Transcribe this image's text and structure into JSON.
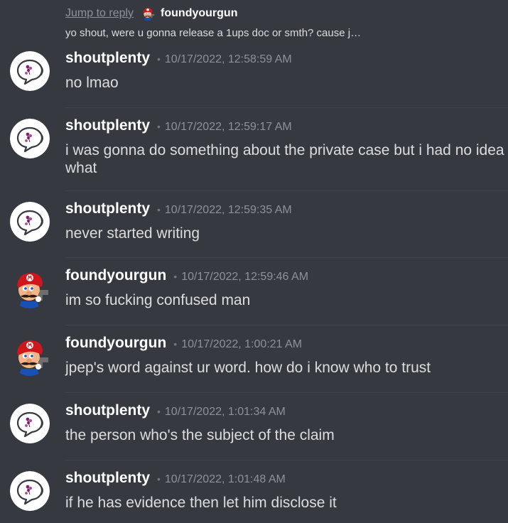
{
  "reply": {
    "jump_label": "Jump to reply",
    "author": "foundyourgun",
    "preview": "yo shout, were u gonna release a 1ups doc or smth? cause j…"
  },
  "colors": {
    "background": "#36393f",
    "username": "#ffffff",
    "message_text": "#dcddde",
    "timestamp": "#8e9297",
    "divider": "#3f4248"
  },
  "messages": [
    {
      "author": "shoutplenty",
      "avatar": "speech-bubble-avatar",
      "separator": "•",
      "timestamp": "10/17/2022, 12:58:59 AM",
      "text": "no lmao"
    },
    {
      "author": "shoutplenty",
      "avatar": "speech-bubble-avatar",
      "separator": "•",
      "timestamp": "10/17/2022, 12:59:17 AM",
      "text": "i was gonna do something about the private case but i had no idea what"
    },
    {
      "author": "shoutplenty",
      "avatar": "speech-bubble-avatar",
      "separator": "•",
      "timestamp": "10/17/2022, 12:59:35 AM",
      "text": "never started writing"
    },
    {
      "author": "foundyourgun",
      "avatar": "mario-avatar",
      "separator": "•",
      "timestamp": "10/17/2022, 12:59:46 AM",
      "text": "im so fucking confused man"
    },
    {
      "author": "foundyourgun",
      "avatar": "mario-avatar",
      "separator": "•",
      "timestamp": "10/17/2022, 1:00:21 AM",
      "text": "jpep's word against ur word. how do i know who to trust"
    },
    {
      "author": "shoutplenty",
      "avatar": "speech-bubble-avatar",
      "separator": "•",
      "timestamp": "10/17/2022, 1:01:34 AM",
      "text": "the person who's the subject of the claim"
    },
    {
      "author": "shoutplenty",
      "avatar": "speech-bubble-avatar",
      "separator": "•",
      "timestamp": "10/17/2022, 1:01:48 AM",
      "text": "if he has evidence then let him disclose it"
    }
  ]
}
